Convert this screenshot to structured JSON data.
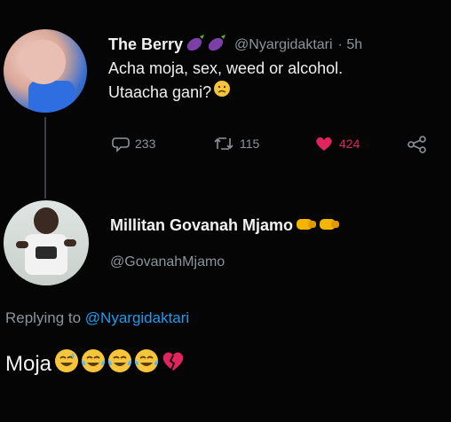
{
  "tweet": {
    "author_name": "The Berry",
    "name_emojis": [
      "eggplant-emoji",
      "eggplant-emoji"
    ],
    "handle": "@Nyargidaktari",
    "time": "· 5h",
    "text_line1": "Acha moja, sex, weed or alcohol.",
    "text_line2": "Utaacha gani?",
    "text_emoji": "confused-face-emoji",
    "replies": "233",
    "retweets": "115",
    "likes": "424",
    "like_color": "#e0245e"
  },
  "reply": {
    "author_name": "Millitan Govanah Mjamo",
    "name_emojis": [
      "fist-emoji",
      "fist-emoji"
    ],
    "handle": "@GovanahMjamo",
    "replying_prefix": "Replying to",
    "replying_handle": "@Nyargidaktari",
    "text": "Moja",
    "text_emojis": [
      "grinning-sweat-emoji",
      "tears-of-joy-emoji",
      "tears-of-joy-emoji",
      "tears-of-joy-emoji",
      "broken-heart-emoji"
    ]
  }
}
